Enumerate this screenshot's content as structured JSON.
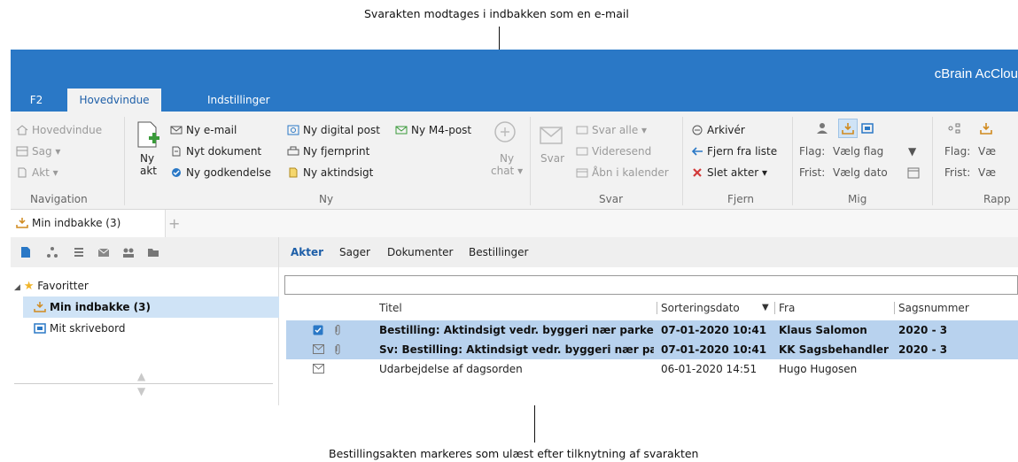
{
  "annotations": {
    "top": "Svarakten modtages i indbakken som en e-mail",
    "bottom": "Bestillingsakten markeres som ulæst efter tilknytning af svarakten"
  },
  "window": {
    "app_title": "cBrain AcClou",
    "tabs": [
      "F2",
      "Hovedvindue",
      "Indstillinger"
    ]
  },
  "ribbon": {
    "navigation": {
      "items": [
        "Hovedvindue",
        "Sag ▾",
        "Akt ▾"
      ],
      "group": "Navigation"
    },
    "ny": {
      "big_button": [
        "Ny",
        "akt"
      ],
      "col1": [
        "Ny e-mail",
        "Nyt dokument",
        "Ny godkendelse"
      ],
      "col2": [
        "Ny digital post",
        "Ny fjernprint",
        "Ny aktindsigt"
      ],
      "col3": [
        "Ny M4-post"
      ],
      "chat": [
        "Ny",
        "chat ▾"
      ],
      "group": "Ny"
    },
    "svar": {
      "big_button": "Svar",
      "items": [
        "Svar alle ▾",
        "Videresend",
        "Åbn i kalender"
      ],
      "group": "Svar"
    },
    "fjern": {
      "items": [
        "Arkivér",
        "Fjern fra liste",
        "Slet akter ▾"
      ],
      "group": "Fjern"
    },
    "mig": {
      "labels": [
        "Flag:",
        "Frist:"
      ],
      "values": [
        "Vælg flag",
        "Vælg dato"
      ],
      "group": "Mig"
    },
    "rapp": {
      "labels": [
        "Flag:",
        "Frist:"
      ],
      "values": [
        "Væ",
        "Væ"
      ],
      "group": "Rapp"
    }
  },
  "doc_tab": {
    "label": "Min indbakke (3)"
  },
  "tree": {
    "favorites": "Favoritter",
    "items": [
      "Min indbakke (3)",
      "Mit skrivebord"
    ]
  },
  "subtabs": [
    "Akter",
    "Sager",
    "Dokumenter",
    "Bestillinger"
  ],
  "table": {
    "columns": [
      "Titel",
      "Sorteringsdato",
      "Fra",
      "Sagsnummer"
    ],
    "rows": [
      {
        "title": "Bestilling: Aktindsigt vedr. byggeri nær parken",
        "date": "07-01-2020 10:41",
        "from": "Klaus Salomon",
        "case": "2020 - 3"
      },
      {
        "title": "Sv: Bestilling: Aktindsigt vedr. byggeri nær pa...",
        "date": "07-01-2020 10:41",
        "from": "KK Sagsbehandler",
        "case": "2020 - 3"
      },
      {
        "title": "Udarbejdelse af dagsorden",
        "date": "06-01-2020 14:51",
        "from": "Hugo Hugosen",
        "case": ""
      }
    ]
  },
  "colors": {
    "titlebar": "#2a78c6",
    "selection": "#b8d2ee",
    "tree_selection": "#cfe3f6"
  }
}
